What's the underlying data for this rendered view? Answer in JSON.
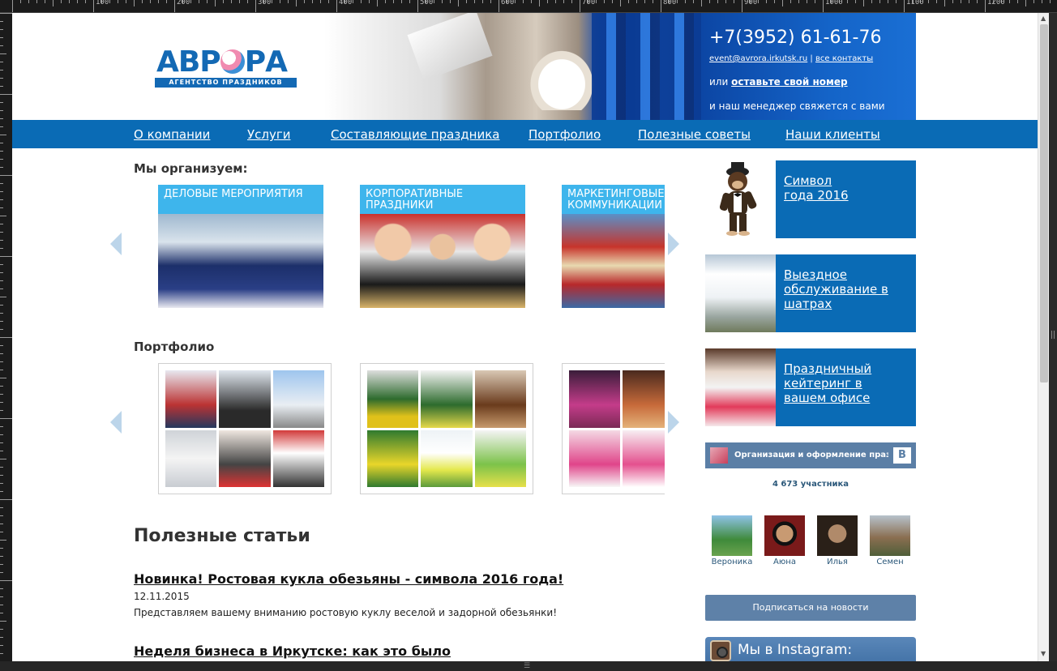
{
  "ruler": {
    "labels": [
      "100",
      "200",
      "300",
      "400",
      "500",
      "600",
      "700",
      "800",
      "900",
      "1000",
      "1100",
      "1200"
    ]
  },
  "header": {
    "logo_text": "АВРОРА",
    "logo_subtitle": "АГЕНТСТВО ПРАЗДНИКОВ",
    "phone": "+7(3952) 61-61-76",
    "email": "event@avrora.irkutsk.ru",
    "separator": "|",
    "all_contacts": "все контакты",
    "or_prefix": "или",
    "leave_number": "оставьте свой номер",
    "manager_text": "и наш менеджер свяжется с вами"
  },
  "nav": {
    "items": [
      {
        "label": "О компании"
      },
      {
        "label": "Услуги"
      },
      {
        "label": "Составляющие праздника"
      },
      {
        "label": "Портфолио"
      },
      {
        "label": "Полезные советы"
      },
      {
        "label": "Наши клиенты"
      }
    ]
  },
  "organize": {
    "title": "Мы организуем:",
    "tiles": [
      {
        "caption": "ДЕЛОВЫЕ МЕРОПРИЯТИЯ"
      },
      {
        "caption": "КОРПОРАТИВНЫЕ ПРАЗДНИКИ"
      },
      {
        "caption": "МАРКЕТИНГОВЫЕ КОММУНИКАЦИИ"
      }
    ]
  },
  "portfolio": {
    "title": "Портфолио"
  },
  "articles": {
    "heading": "Полезные статьи",
    "items": [
      {
        "title": "Новинка! Ростовая кукла обезьяны - символа 2016 года!",
        "date": "12.11.2015",
        "text": "Представляем вашему вниманию ростовую куклу веселой и задорной обезьянки!"
      },
      {
        "title": "Неделя бизнеса в Иркутске: как это было"
      }
    ]
  },
  "sidebar": {
    "promos": [
      {
        "label": "Символ года 2016"
      },
      {
        "label": "Выездное обслуживание в шатрах"
      },
      {
        "label": "Праздничный кейтеринг в вашем офисе"
      }
    ],
    "vk": {
      "group_name": "Организация и оформление праздников",
      "logo": "B",
      "members_count": "4 673 участника",
      "members": [
        {
          "name": "Вероника"
        },
        {
          "name": "Аюна"
        },
        {
          "name": "Илья"
        },
        {
          "name": "Семен"
        }
      ],
      "subscribe": "Подписаться на новости"
    },
    "instagram": {
      "label": "Мы в Instagram:"
    }
  },
  "colors": {
    "brand_blue": "#0a6bb5",
    "caption_blue": "#3eb5ec",
    "vk_blue": "#5b7fa6"
  }
}
